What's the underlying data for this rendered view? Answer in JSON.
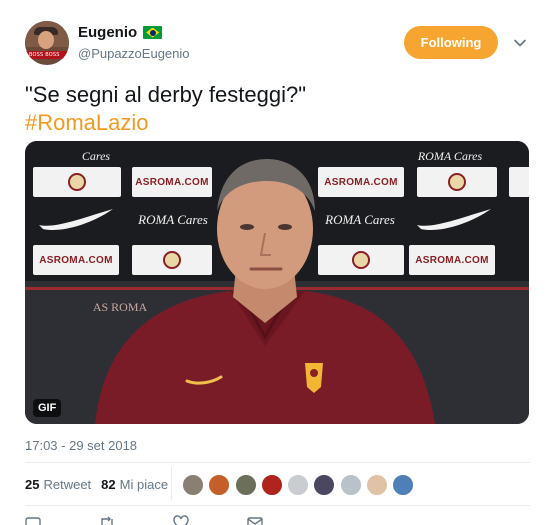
{
  "user": {
    "display_name": "Eugenio",
    "handle": "@PupazzoEugenio",
    "flag_icon": "brazil-flag-icon",
    "avatar_text": "BOSS BOSS"
  },
  "follow_button": {
    "label": "Following",
    "color": "#f7a531"
  },
  "tweet": {
    "text": "\"Se segni al derby festeggi?\"",
    "hashtag": "#RomaLazio",
    "hashtag_color": "#f29a1f"
  },
  "media": {
    "badge": "GIF",
    "backdrop_labels": [
      "Cares",
      "ASROMA.COM",
      "ROMA Cares",
      "ASROMA.COM",
      "AS ROMA"
    ]
  },
  "timestamp": "17:03 - 29 set 2018",
  "stats": {
    "retweet_count": "25",
    "retweet_label": "Retweet",
    "like_count": "82",
    "like_label": "Mi piace"
  },
  "liker_colors": [
    "#8a7f73",
    "#c45f2b",
    "#6c6f59",
    "#b0241e",
    "#c9ccd0",
    "#4b4761",
    "#b9c2c9",
    "#e0c3a7",
    "#4f7fb7"
  ],
  "actions": [
    "reply-icon",
    "retweet-icon",
    "like-icon",
    "dm-icon"
  ]
}
